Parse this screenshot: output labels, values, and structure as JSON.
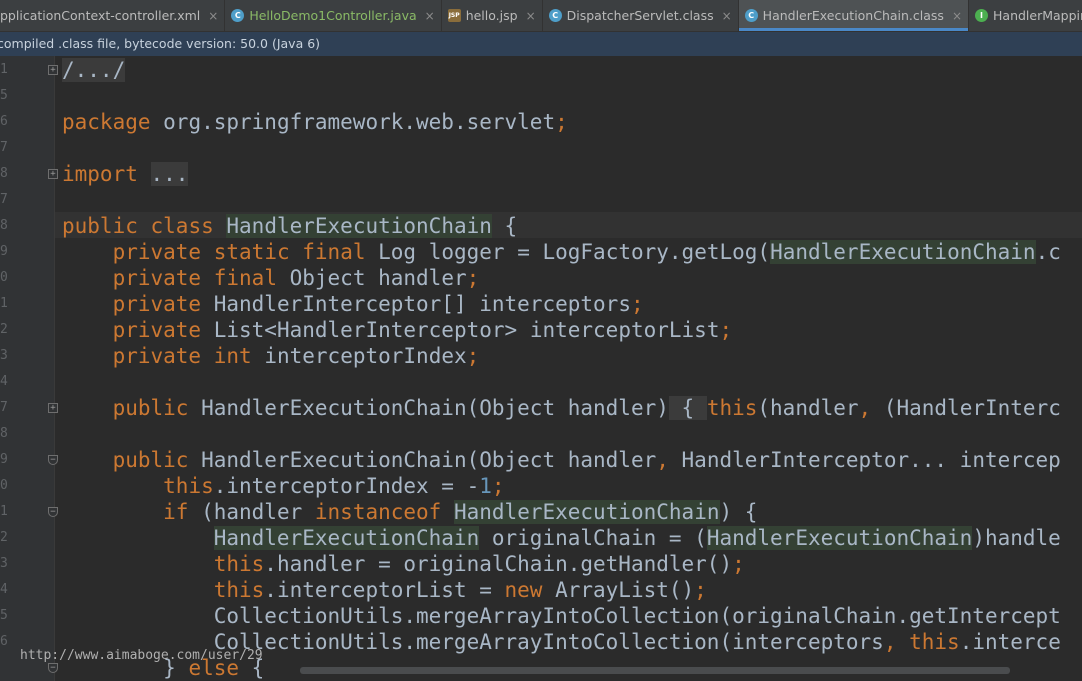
{
  "tabs": [
    {
      "label": "pplicationContext-controller.xml",
      "icon": "xml-file-icon",
      "active": false,
      "green": false
    },
    {
      "label": "HelloDemo1Controller.java",
      "icon": "class-icon",
      "active": false,
      "green": true
    },
    {
      "label": "hello.jsp",
      "icon": "jsp-file-icon",
      "active": false,
      "green": false
    },
    {
      "label": "DispatcherServlet.class",
      "icon": "class-icon",
      "active": false,
      "green": false
    },
    {
      "label": "HandlerExecutionChain.class",
      "icon": "class-icon",
      "active": true,
      "green": false
    },
    {
      "label": "HandlerMapping.class",
      "icon": "interface-icon",
      "active": false,
      "green": false
    }
  ],
  "infobar": {
    "text": "compiled .class file, bytecode version: 50.0 (Java 6)"
  },
  "line_numbers": [
    "1",
    "5",
    "6",
    "7",
    "8",
    "7",
    "8",
    "9",
    "0",
    "1",
    "2",
    "3",
    "4",
    "7",
    "8",
    "9",
    "0",
    "1",
    "2",
    "3",
    "4",
    "5",
    "6"
  ],
  "code_lines": [
    [
      {
        "t": "/.../",
        "c": "folded"
      }
    ],
    [],
    [
      {
        "t": "package",
        "c": "kw"
      },
      {
        "t": " org.springframework.web.servlet"
      },
      {
        "t": ";",
        "c": "kw"
      }
    ],
    [],
    [
      {
        "t": "import",
        "c": "kw"
      },
      {
        "t": " "
      },
      {
        "t": "...",
        "c": "folded"
      }
    ],
    [],
    [
      {
        "t": "public",
        "c": "kw"
      },
      {
        "t": " "
      },
      {
        "t": "class",
        "c": "kw"
      },
      {
        "t": " "
      },
      {
        "t": "HandlerExecutionChain",
        "c": "cls"
      },
      {
        "t": " {"
      }
    ],
    [
      {
        "t": "    "
      },
      {
        "t": "private",
        "c": "kw"
      },
      {
        "t": " "
      },
      {
        "t": "static",
        "c": "kw"
      },
      {
        "t": " "
      },
      {
        "t": "final",
        "c": "kw"
      },
      {
        "t": " Log logger = LogFactory.getLog("
      },
      {
        "t": "HandlerExecutionChain",
        "c": "cls"
      },
      {
        "t": ".c"
      }
    ],
    [
      {
        "t": "    "
      },
      {
        "t": "private",
        "c": "kw"
      },
      {
        "t": " "
      },
      {
        "t": "final",
        "c": "kw"
      },
      {
        "t": " Object handler"
      },
      {
        "t": ";",
        "c": "kw"
      }
    ],
    [
      {
        "t": "    "
      },
      {
        "t": "private",
        "c": "kw"
      },
      {
        "t": " HandlerInterceptor[] interceptors"
      },
      {
        "t": ";",
        "c": "kw"
      }
    ],
    [
      {
        "t": "    "
      },
      {
        "t": "private",
        "c": "kw"
      },
      {
        "t": " List<HandlerInterceptor> interceptorList"
      },
      {
        "t": ";",
        "c": "kw"
      }
    ],
    [
      {
        "t": "    "
      },
      {
        "t": "private",
        "c": "kw"
      },
      {
        "t": " "
      },
      {
        "t": "int",
        "c": "kw"
      },
      {
        "t": " interceptorIndex"
      },
      {
        "t": ";",
        "c": "kw"
      }
    ],
    [],
    [
      {
        "t": "    "
      },
      {
        "t": "public",
        "c": "kw"
      },
      {
        "t": " HandlerExecutionChain(Object handler)"
      },
      {
        "t": " { ",
        "c": "folded"
      },
      {
        "t": "this",
        "c": "kw"
      },
      {
        "t": "(handler"
      },
      {
        "t": ",",
        "c": "kw"
      },
      {
        "t": " (HandlerInterc"
      }
    ],
    [],
    [
      {
        "t": "    "
      },
      {
        "t": "public",
        "c": "kw"
      },
      {
        "t": " HandlerExecutionChain(Object handler"
      },
      {
        "t": ",",
        "c": "kw"
      },
      {
        "t": " HandlerInterceptor... intercep"
      }
    ],
    [
      {
        "t": "        "
      },
      {
        "t": "this",
        "c": "kw"
      },
      {
        "t": ".interceptorIndex = -"
      },
      {
        "t": "1",
        "c": "num"
      },
      {
        "t": ";",
        "c": "kw"
      }
    ],
    [
      {
        "t": "        "
      },
      {
        "t": "if",
        "c": "kw"
      },
      {
        "t": " (handler "
      },
      {
        "t": "instanceof",
        "c": "kw"
      },
      {
        "t": " "
      },
      {
        "t": "HandlerExecutionChain",
        "c": "cls"
      },
      {
        "t": ") {"
      }
    ],
    [
      {
        "t": "            "
      },
      {
        "t": "HandlerExecutionChain",
        "c": "cls"
      },
      {
        "t": " originalChain = ("
      },
      {
        "t": "HandlerExecutionChain",
        "c": "cls"
      },
      {
        "t": ")handle"
      }
    ],
    [
      {
        "t": "            "
      },
      {
        "t": "this",
        "c": "kw"
      },
      {
        "t": ".handler = originalChain.getHandler()"
      },
      {
        "t": ";",
        "c": "kw"
      }
    ],
    [
      {
        "t": "            "
      },
      {
        "t": "this",
        "c": "kw"
      },
      {
        "t": ".interceptorList = "
      },
      {
        "t": "new",
        "c": "kw"
      },
      {
        "t": " ArrayList()"
      },
      {
        "t": ";",
        "c": "kw"
      }
    ],
    [
      {
        "t": "            CollectionUtils.mergeArrayIntoCollection(originalChain.getIntercept"
      }
    ],
    [
      {
        "t": "            CollectionUtils.mergeArrayIntoCollection(interceptors"
      },
      {
        "t": ",",
        "c": "kw"
      },
      {
        "t": " "
      },
      {
        "t": "this",
        "c": "kw"
      },
      {
        "t": ".interce"
      }
    ],
    [
      {
        "t": "        } "
      },
      {
        "t": "else",
        "c": "kw"
      },
      {
        "t": " {"
      }
    ]
  ],
  "watermark": "http://www.aimaboge.com/user/29",
  "colors": {
    "background": "#2b2b2b",
    "keyword": "#cc7832",
    "text": "#a9b7c6",
    "number": "#6897bb",
    "active_tab_underline": "#4a88c7"
  }
}
